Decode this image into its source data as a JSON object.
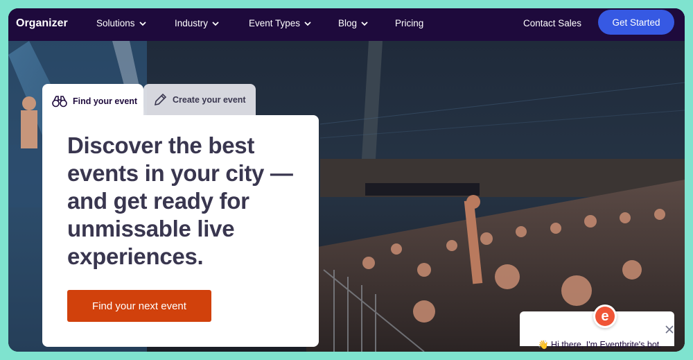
{
  "nav": {
    "logo": "Organizer",
    "items": [
      {
        "label": "Solutions"
      },
      {
        "label": "Industry"
      },
      {
        "label": "Event Types"
      },
      {
        "label": "Blog"
      },
      {
        "label": "Pricing"
      }
    ],
    "contact": "Contact Sales",
    "cta": "Get Started"
  },
  "search": {
    "tabs": [
      {
        "label": "Find your event",
        "icon": "binoculars-icon",
        "active": true
      },
      {
        "label": "Create your event",
        "icon": "pencil-icon",
        "active": false
      }
    ],
    "headline": "Discover the best events in your city — and get ready for unmissable live experiences.",
    "button": "Find your next event"
  },
  "chat": {
    "brand_icon": "eventbrite-logo-icon",
    "message": "👋 Hi there, I'm Eventbrite's bot."
  },
  "colors": {
    "nav_bg": "#1e0a3c",
    "cta_bg": "#3659e3",
    "accent_orange": "#d1410c",
    "frame_bg": "#7fe3cf"
  }
}
